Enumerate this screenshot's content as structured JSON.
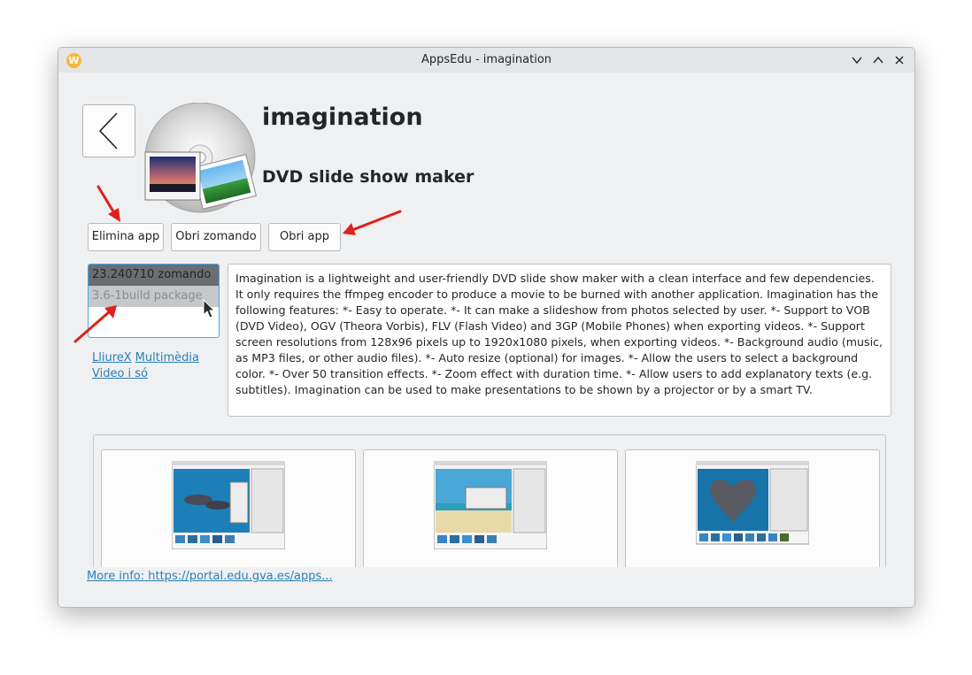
{
  "window": {
    "title": "AppsEdu - imagination",
    "app_icon_letter": "W"
  },
  "app": {
    "name": "imagination",
    "summary": "DVD slide show maker",
    "back_icon": "chevron-left-icon"
  },
  "actions": {
    "remove": "Elimina app",
    "open_zomando": "Obri zomando",
    "open_app": "Obri app"
  },
  "packages": [
    {
      "label": "23.240710 zomando",
      "state": "selected"
    },
    {
      "label": "3.6-1build package",
      "state": "hover"
    }
  ],
  "tags": [
    "LliureX",
    "Multimèdia",
    "Video i só"
  ],
  "description": "Imagination is a lightweight and user-friendly DVD slide show maker with a clean interface and few dependencies. It only requires the ffmpeg encoder to produce a movie to be burned with another application. Imagination has the following features: *- Easy to operate. *- It can make a slideshow from photos selected by user. *- Support to VOB (DVD Video), OGV (Theora Vorbis), FLV (Flash Video) and 3GP (Mobile Phones) when exporting videos. *- Support screen resolutions from 128x96 pixels up to 1920x1080 pixels, when exporting videos. *- Background audio (music, as MP3 files, or other audio files). *- Auto resize (optional) for images. *- Allow the users to select a background color. *- Over 50 transition effects. *- Zoom effect with duration time. *- Allow users to add explanatory texts (e.g. subtitles). Imagination can be used to make presentations to be shown by a projector or by a smart TV.",
  "more_info": "More info: https://portal.edu.gva.es/apps...",
  "colors": {
    "accent": "#3daee9",
    "link": "#2980b9",
    "annotation": "#e0201b"
  }
}
